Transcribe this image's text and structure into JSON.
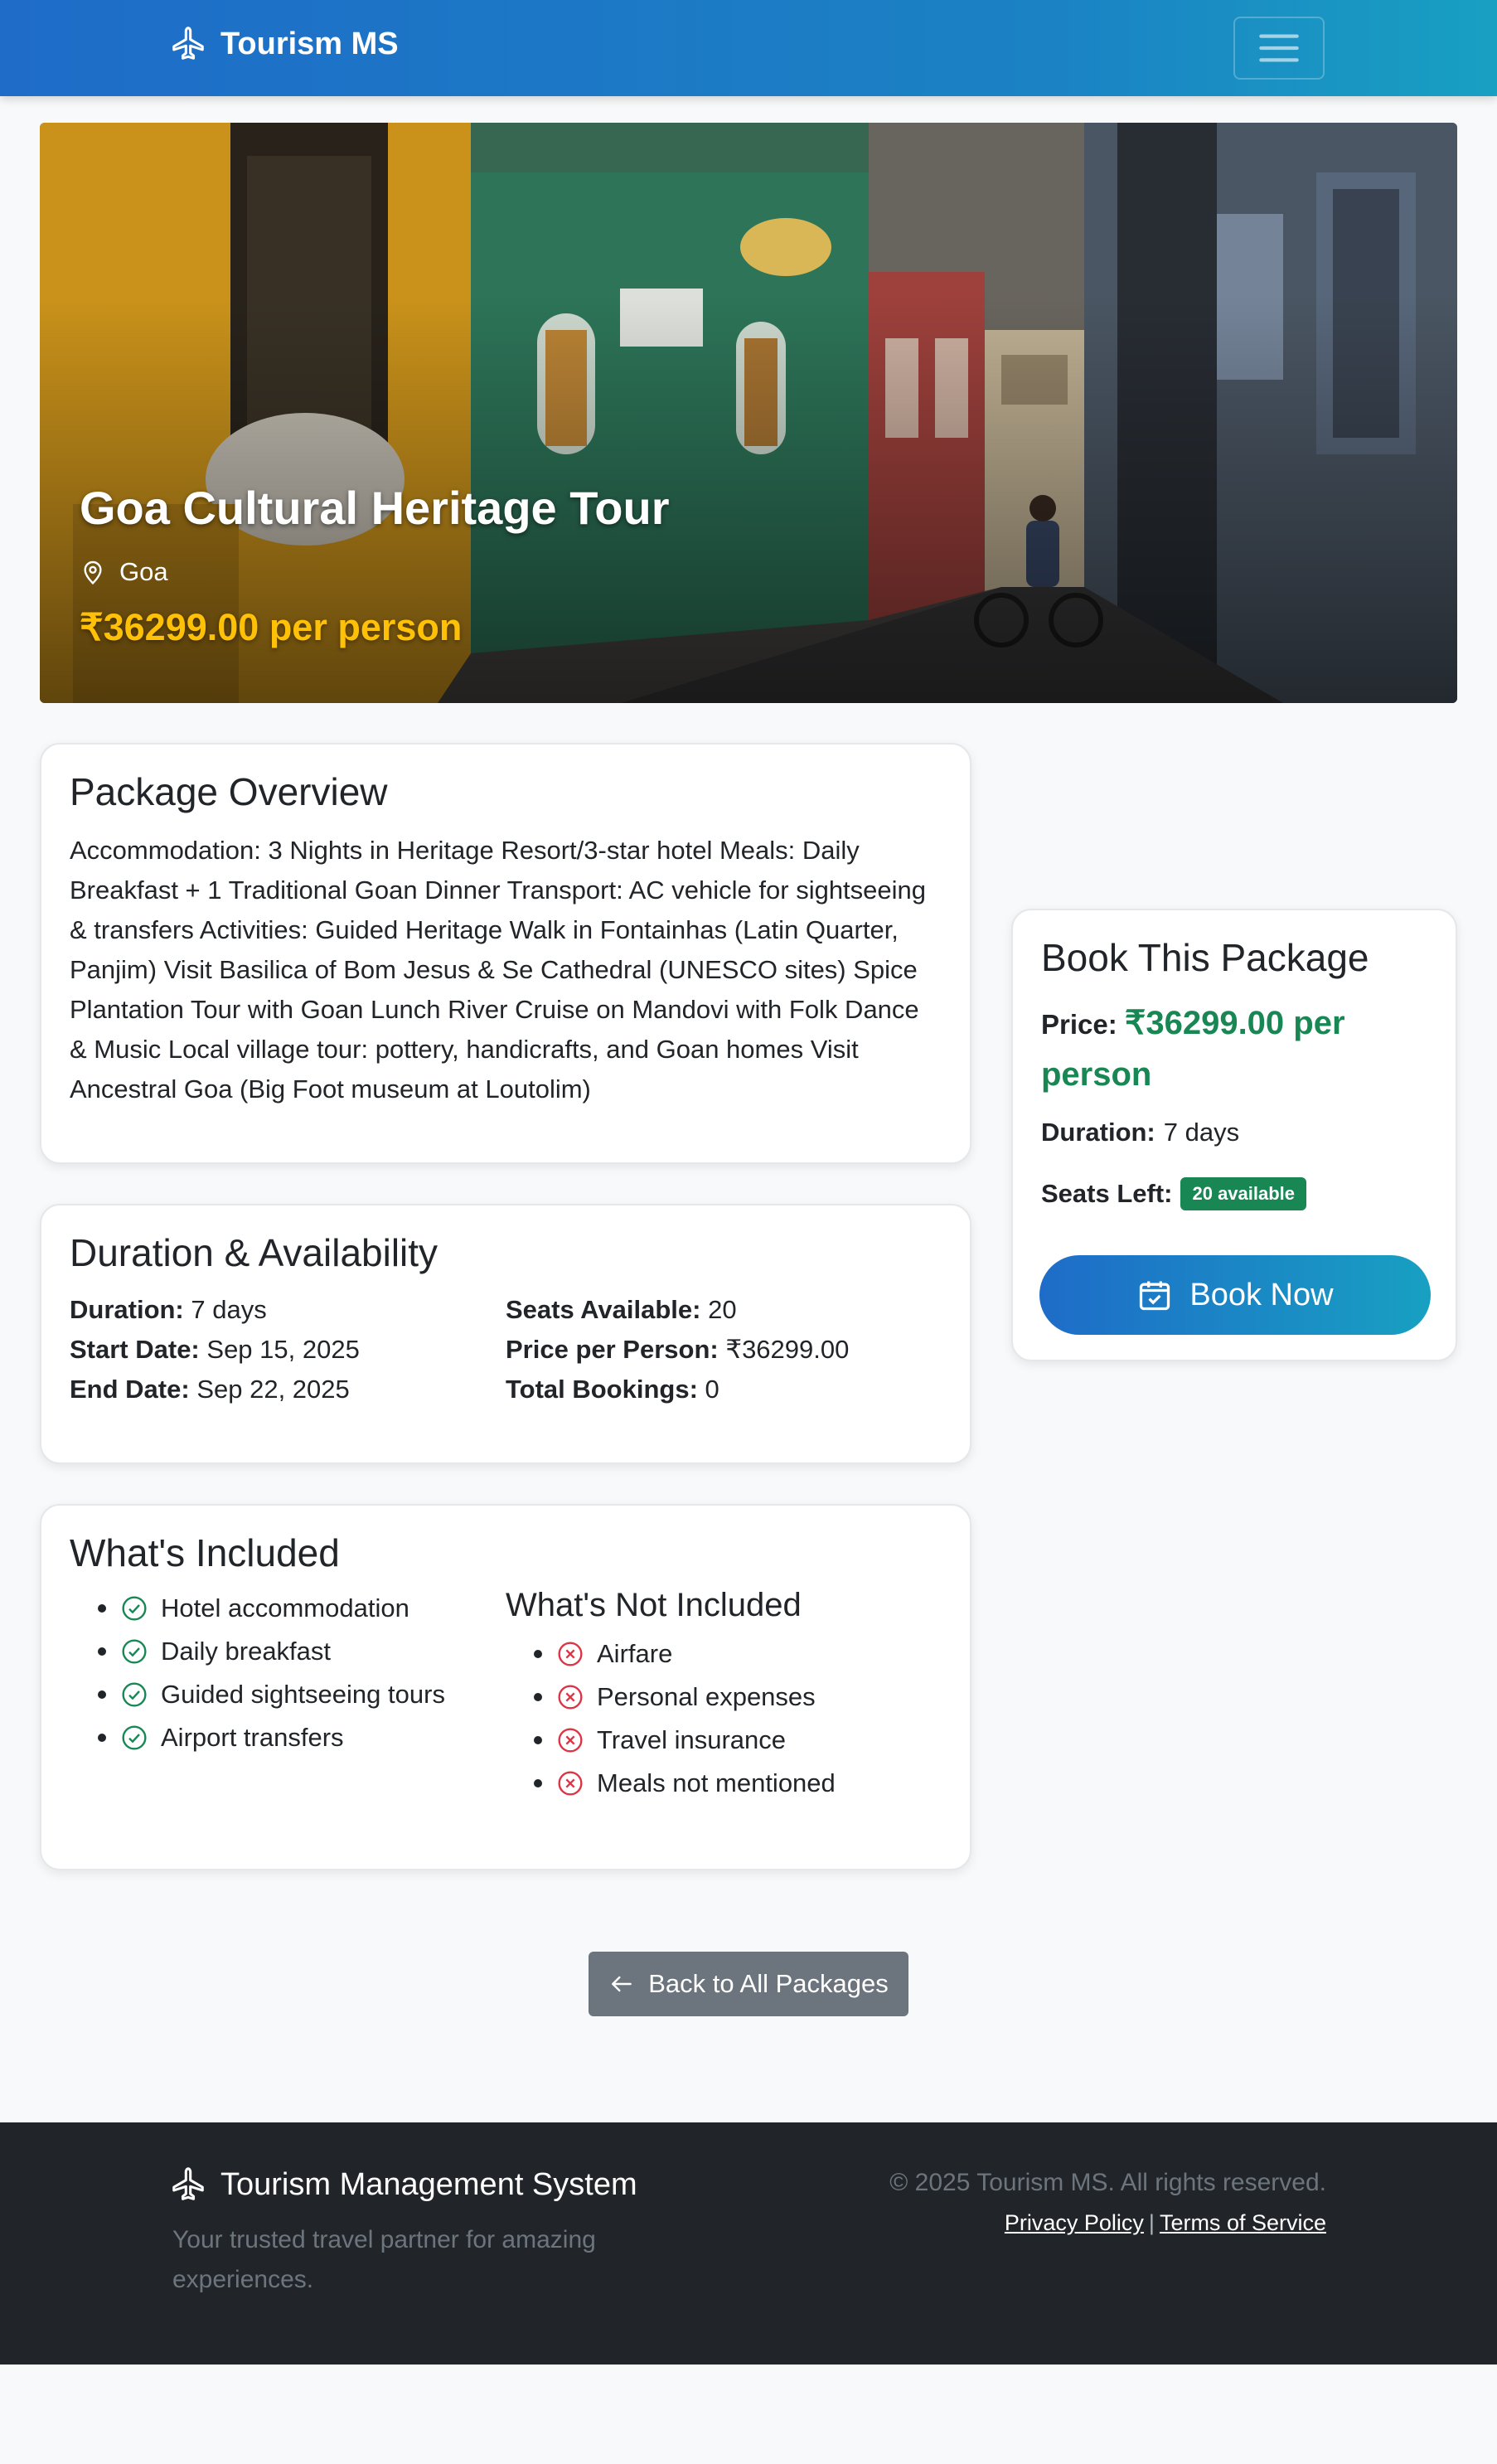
{
  "nav": {
    "brand": "Tourism MS",
    "brand_icon": "airplane-icon",
    "menu_icon": "hamburger-icon"
  },
  "hero": {
    "title": "Goa Cultural Heritage Tour",
    "location": "Goa",
    "price": "₹36299.00 per person"
  },
  "overview": {
    "heading": "Package Overview",
    "text": "Accommodation: 3 Nights in Heritage Resort/3-star hotel Meals: Daily Breakfast + 1 Traditional Goan Dinner Transport: AC vehicle for sightseeing & transfers Activities: Guided Heritage Walk in Fontainhas (Latin Quarter, Panjim) Visit Basilica of Bom Jesus & Se Cathedral (UNESCO sites) Spice Plantation Tour with Goan Lunch River Cruise on Mandovi with Folk Dance & Music Local village tour: pottery, handicrafts, and Goan homes Visit Ancestral Goa (Big Foot museum at Loutolim)"
  },
  "availability": {
    "heading": "Duration & Availability",
    "left": [
      {
        "label": "Duration:",
        "value": "7 days"
      },
      {
        "label": "Start Date:",
        "value": "Sep 15, 2025"
      },
      {
        "label": "End Date:",
        "value": "Sep 22, 2025"
      }
    ],
    "right": [
      {
        "label": "Seats Available:",
        "value": "20"
      },
      {
        "label": "Price per Person:",
        "value": "₹36299.00"
      },
      {
        "label": "Total Bookings:",
        "value": "0"
      }
    ]
  },
  "included": {
    "heading": "What's Included",
    "items": [
      "Hotel accommodation",
      "Daily breakfast",
      "Guided sightseeing tours",
      "Airport transfers"
    ],
    "not_heading": "What's Not Included",
    "not_items": [
      "Airfare",
      "Personal expenses",
      "Travel insurance",
      "Meals not mentioned"
    ]
  },
  "booking": {
    "heading": "Book This Package",
    "price_label": "Price:",
    "price_value": "₹36299.00 per person",
    "duration_label": "Duration:",
    "duration_value": "7 days",
    "seats_label": "Seats Left:",
    "seats_badge": "20 available",
    "button": "Book Now"
  },
  "back_button": "Back to All Packages",
  "footer": {
    "brand": "Tourism Management System",
    "tagline": "Your trusted travel partner for amazing experiences.",
    "copyright": "© 2025 Tourism MS. All rights reserved.",
    "privacy": "Privacy Policy",
    "separator": "|",
    "terms": "Terms of Service"
  },
  "colors": {
    "primary": "#1e6cc8",
    "accent": "#18a0c2",
    "success": "#198754",
    "warning": "#ffc107",
    "footer_bg": "#212529"
  }
}
